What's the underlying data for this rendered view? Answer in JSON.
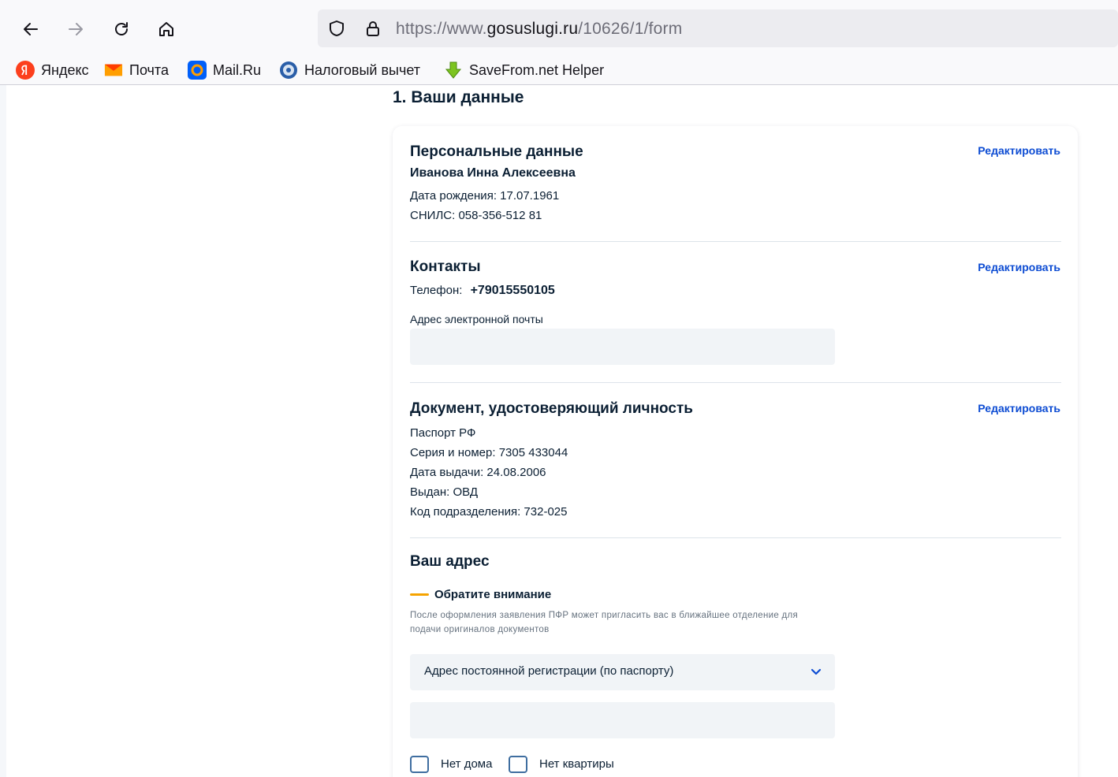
{
  "browser": {
    "url_prefix": "https://www.",
    "url_domain": "gosuslugi.ru",
    "url_path": "/10626/1/form",
    "bookmarks": [
      {
        "label": "Яндекс",
        "icon": "yandex-icon"
      },
      {
        "label": "Почта",
        "icon": "mail-envelope-icon"
      },
      {
        "label": "Mail.Ru",
        "icon": "mailru-icon"
      },
      {
        "label": "Налоговый вычет",
        "icon": "tax-deduction-icon"
      },
      {
        "label": "SaveFrom.net Helper",
        "icon": "download-arrow-icon"
      }
    ],
    "colors": {
      "yandex": "#fc3f1d",
      "mail": "#ff9e00",
      "mailru": "#005ff9",
      "savefrom": "#7dc420"
    }
  },
  "page": {
    "section_title": "1. Ваши данные",
    "personal": {
      "title": "Персональные данные",
      "edit": "Редактировать",
      "name": "Иванова Инна Алексеевна",
      "birth_date": "Дата рождения: 17.07.1961",
      "snils": "СНИЛС: 058-356-512 81"
    },
    "contacts": {
      "title": "Контакты",
      "edit": "Редактировать",
      "phone_label": "Телефон:",
      "phone_value": "+79015550105",
      "email_label": "Адрес электронной почты",
      "email_value": ""
    },
    "document": {
      "title": "Документ, удостоверяющий личность",
      "edit": "Редактировать",
      "type": "Паспорт РФ",
      "series": "Серия и номер: 7305 433044",
      "issue_date": "Дата выдачи: 24.08.2006",
      "issued_by": "Выдан: ОВД",
      "dept_code": "Код подразделения: 732-025"
    },
    "address": {
      "title": "Ваш адрес",
      "notice_title": "Обратите внимание",
      "notice_text": "После оформления заявления ПФР может пригласить вас в ближайшее отделение для подачи оригиналов документов",
      "address_type": "Адрес постоянной регистрации (по паспорту)",
      "address_value": "",
      "no_house": "Нет дома",
      "no_flat": "Нет квартиры"
    },
    "colors": {
      "link": "#0d4cd3",
      "notice_accent": "#f5a300",
      "field_bg": "#f1f4f7"
    }
  }
}
